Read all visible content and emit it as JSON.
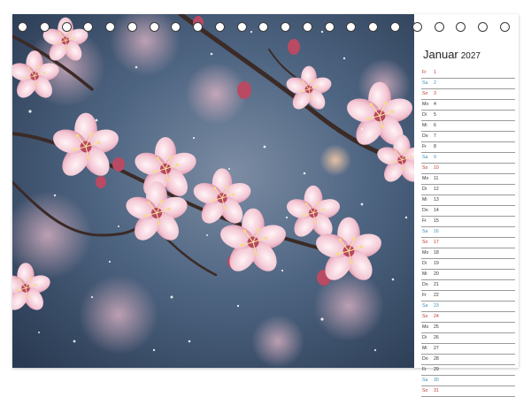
{
  "calendar": {
    "month": "Januar",
    "year": "2027",
    "days": [
      {
        "wd": "Fr",
        "dn": "1",
        "kind": "hol"
      },
      {
        "wd": "Sa",
        "dn": "2",
        "kind": "sat"
      },
      {
        "wd": "So",
        "dn": "3",
        "kind": "sun"
      },
      {
        "wd": "Mo",
        "dn": "4",
        "kind": ""
      },
      {
        "wd": "Di",
        "dn": "5",
        "kind": ""
      },
      {
        "wd": "Mi",
        "dn": "6",
        "kind": ""
      },
      {
        "wd": "Do",
        "dn": "7",
        "kind": ""
      },
      {
        "wd": "Fr",
        "dn": "8",
        "kind": ""
      },
      {
        "wd": "Sa",
        "dn": "9",
        "kind": "sat"
      },
      {
        "wd": "So",
        "dn": "10",
        "kind": "sun"
      },
      {
        "wd": "Mo",
        "dn": "11",
        "kind": ""
      },
      {
        "wd": "Di",
        "dn": "12",
        "kind": ""
      },
      {
        "wd": "Mi",
        "dn": "13",
        "kind": ""
      },
      {
        "wd": "Do",
        "dn": "14",
        "kind": ""
      },
      {
        "wd": "Fr",
        "dn": "15",
        "kind": ""
      },
      {
        "wd": "Sa",
        "dn": "16",
        "kind": "sat"
      },
      {
        "wd": "So",
        "dn": "17",
        "kind": "sun"
      },
      {
        "wd": "Mo",
        "dn": "18",
        "kind": ""
      },
      {
        "wd": "Di",
        "dn": "19",
        "kind": ""
      },
      {
        "wd": "Mi",
        "dn": "20",
        "kind": ""
      },
      {
        "wd": "Do",
        "dn": "21",
        "kind": ""
      },
      {
        "wd": "Fr",
        "dn": "22",
        "kind": ""
      },
      {
        "wd": "Sa",
        "dn": "23",
        "kind": "sat"
      },
      {
        "wd": "So",
        "dn": "24",
        "kind": "sun"
      },
      {
        "wd": "Mo",
        "dn": "25",
        "kind": ""
      },
      {
        "wd": "Di",
        "dn": "26",
        "kind": ""
      },
      {
        "wd": "Mi",
        "dn": "27",
        "kind": ""
      },
      {
        "wd": "Do",
        "dn": "28",
        "kind": ""
      },
      {
        "wd": "Fr",
        "dn": "29",
        "kind": ""
      },
      {
        "wd": "Sa",
        "dn": "30",
        "kind": "sat"
      },
      {
        "wd": "So",
        "dn": "31",
        "kind": "sun"
      }
    ]
  },
  "photo": {
    "subject": "pink-cherry-blossom-branches-in-snowfall"
  },
  "colors": {
    "saturday": "#3c8fbf",
    "sunday_holiday": "#c0392b",
    "background_blue": "#4a6280",
    "blossom_pink": "#f2c4d0"
  }
}
